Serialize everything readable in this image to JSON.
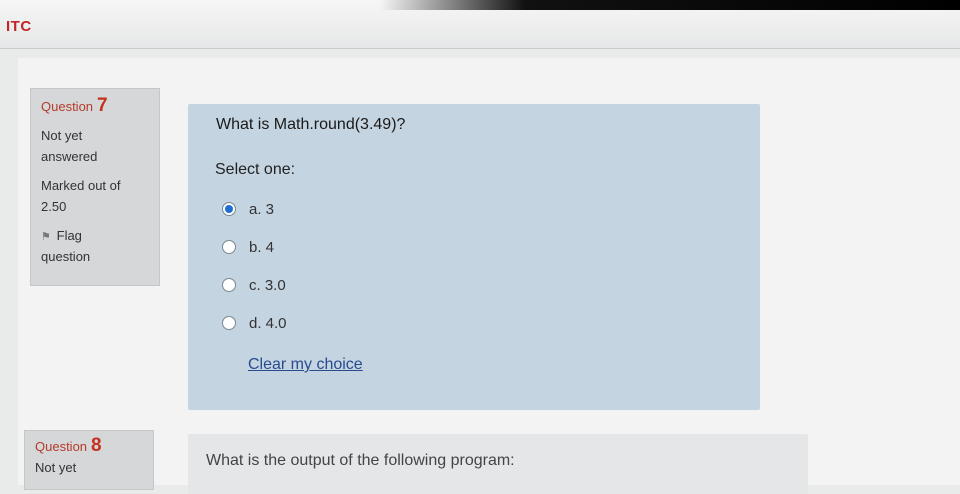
{
  "app": {
    "title": "ITC"
  },
  "question7": {
    "label": "Question",
    "number": "7",
    "status_line1": "Not yet",
    "status_line2": "answered",
    "marks_line1": "Marked out of",
    "marks_line2": "2.50",
    "flag_line1": "Flag",
    "flag_line2": "question",
    "text": "What is Math.round(3.49)?",
    "prompt": "Select one:",
    "options": [
      {
        "label": "a. 3",
        "selected": true
      },
      {
        "label": "b. 4",
        "selected": false
      },
      {
        "label": "c. 3.0",
        "selected": false
      },
      {
        "label": "d. 4.0",
        "selected": false
      }
    ],
    "clear_label": "Clear my choice"
  },
  "question8": {
    "label": "Question",
    "number": "8",
    "status_line1": "Not yet",
    "text": "What is the output of the following program:"
  },
  "colors": {
    "title_red": "#c32427",
    "content_blue": "#c4d4e1",
    "info_gray": "#d6d7d9",
    "selected_radio": "#1f6fd0",
    "link_blue": "#2a4b8d"
  }
}
